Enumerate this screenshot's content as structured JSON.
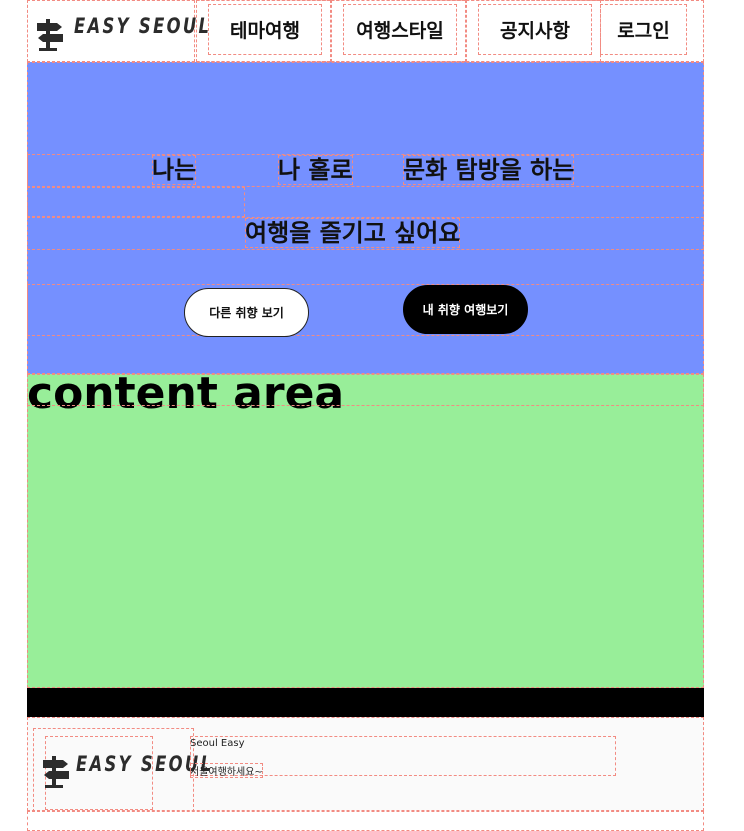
{
  "header": {
    "logo_text": "EASY SEOUL",
    "nav": [
      {
        "label": "테마여행"
      },
      {
        "label": "여행스타일"
      },
      {
        "label": "공지사항"
      },
      {
        "label": "로그인"
      }
    ]
  },
  "hero": {
    "line1": [
      "나는",
      "나 홀로",
      "문화 탐방을 하는"
    ],
    "line2": "여행을 즐기고 싶어요",
    "buttons": {
      "other": "다른 취향 보기",
      "mine": "내 취향 여행보기"
    }
  },
  "content": {
    "title": "content area"
  },
  "footer": {
    "logo_text": "EASY SEOUL",
    "line1": "Seoul Easy",
    "line2": "서울여행하세요~"
  },
  "colors": {
    "hero_bg": "#7590ff",
    "content_bg": "#98ee99",
    "band_bg": "#000000"
  },
  "icons": {
    "logo": "signpost-icon"
  }
}
